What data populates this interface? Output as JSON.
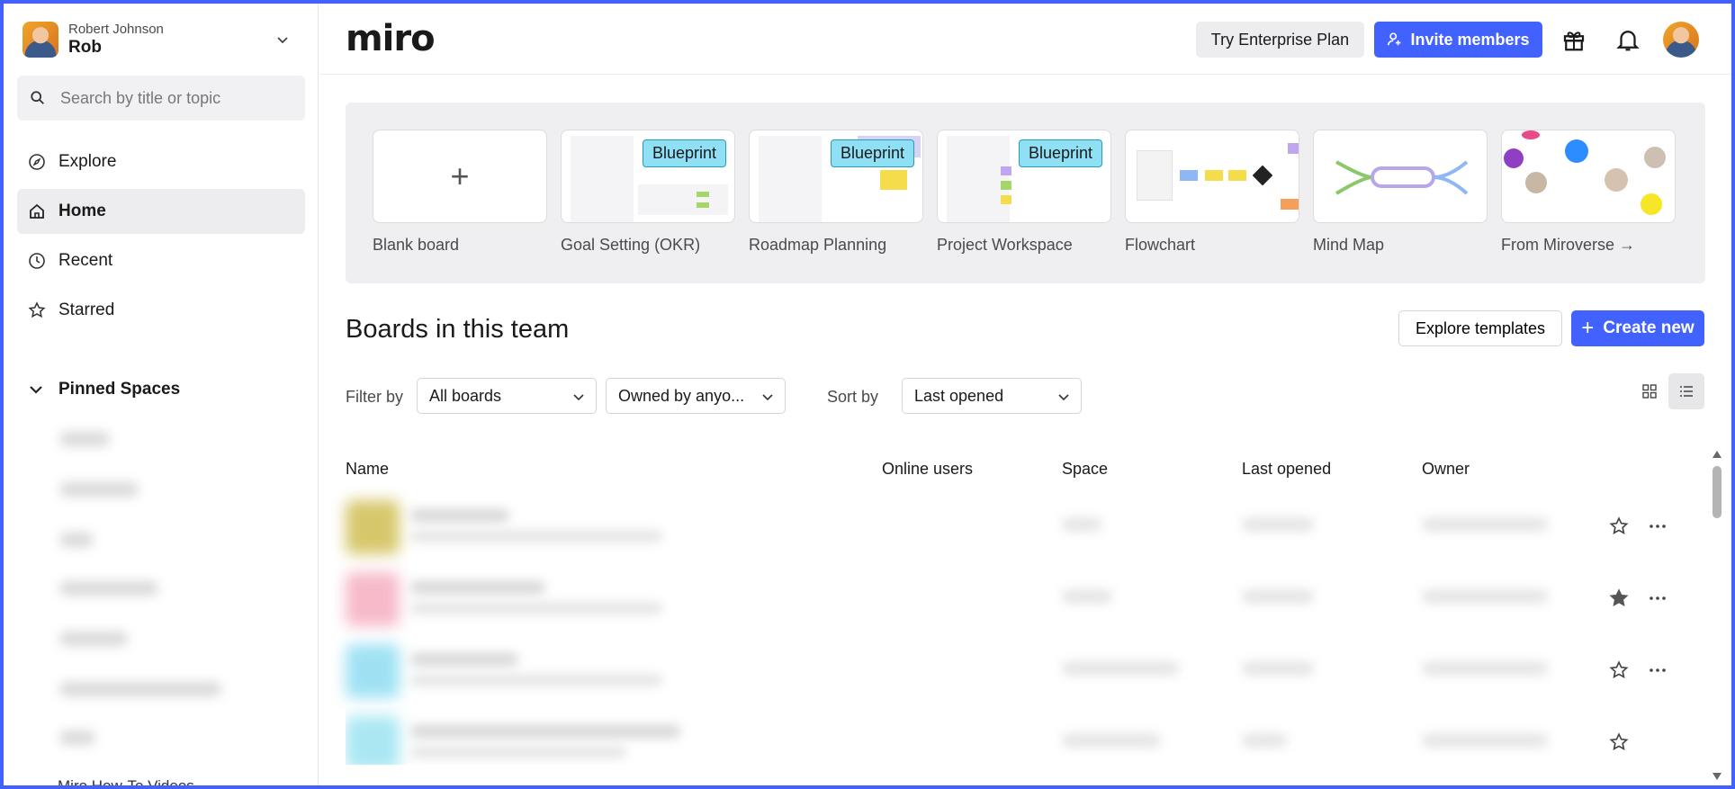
{
  "sidebar": {
    "user": {
      "full_name": "Robert Johnson",
      "short_name": "Rob"
    },
    "search": {
      "placeholder": "Search by title or topic"
    },
    "nav": [
      {
        "label": "Explore",
        "icon": "compass-icon",
        "active": false
      },
      {
        "label": "Home",
        "icon": "home-icon",
        "active": true
      },
      {
        "label": "Recent",
        "icon": "clock-icon",
        "active": false
      },
      {
        "label": "Starred",
        "icon": "star-icon",
        "active": false
      }
    ],
    "pinned_title": "Pinned Spaces",
    "last_item": "Miro How-To Videos"
  },
  "header": {
    "logo": "miro",
    "enterprise_label": "Try Enterprise Plan",
    "invite_label": "Invite members",
    "icons": [
      "gift-icon",
      "bell-icon",
      "avatar"
    ]
  },
  "templates": [
    {
      "label": "Blank board",
      "badge": ""
    },
    {
      "label": "Goal Setting (OKR)",
      "badge": "Blueprint"
    },
    {
      "label": "Roadmap Planning",
      "badge": "Blueprint"
    },
    {
      "label": "Project Workspace",
      "badge": "Blueprint"
    },
    {
      "label": "Flowchart",
      "badge": ""
    },
    {
      "label": "Mind Map",
      "badge": ""
    },
    {
      "label": "From Miroverse →",
      "badge": ""
    }
  ],
  "boards": {
    "title": "Boards in this team",
    "explore_label": "Explore templates",
    "create_label": "Create new",
    "filter_label": "Filter by",
    "filter_value": "All boards",
    "owner_value": "Owned by anyo...",
    "sort_label": "Sort by",
    "sort_value": "Last opened",
    "columns": [
      "Name",
      "Online users",
      "Space",
      "Last opened",
      "Owner"
    ],
    "rows": [
      {
        "starred": false,
        "color": "#c9b53a"
      },
      {
        "starred": true,
        "color": "#f4a3b8"
      },
      {
        "starred": false,
        "color": "#7fd8f0"
      },
      {
        "starred": false,
        "color": "#8ee0f0"
      }
    ]
  },
  "colors": {
    "accent": "#4262ff",
    "blueprint": "#8fe0f5"
  }
}
